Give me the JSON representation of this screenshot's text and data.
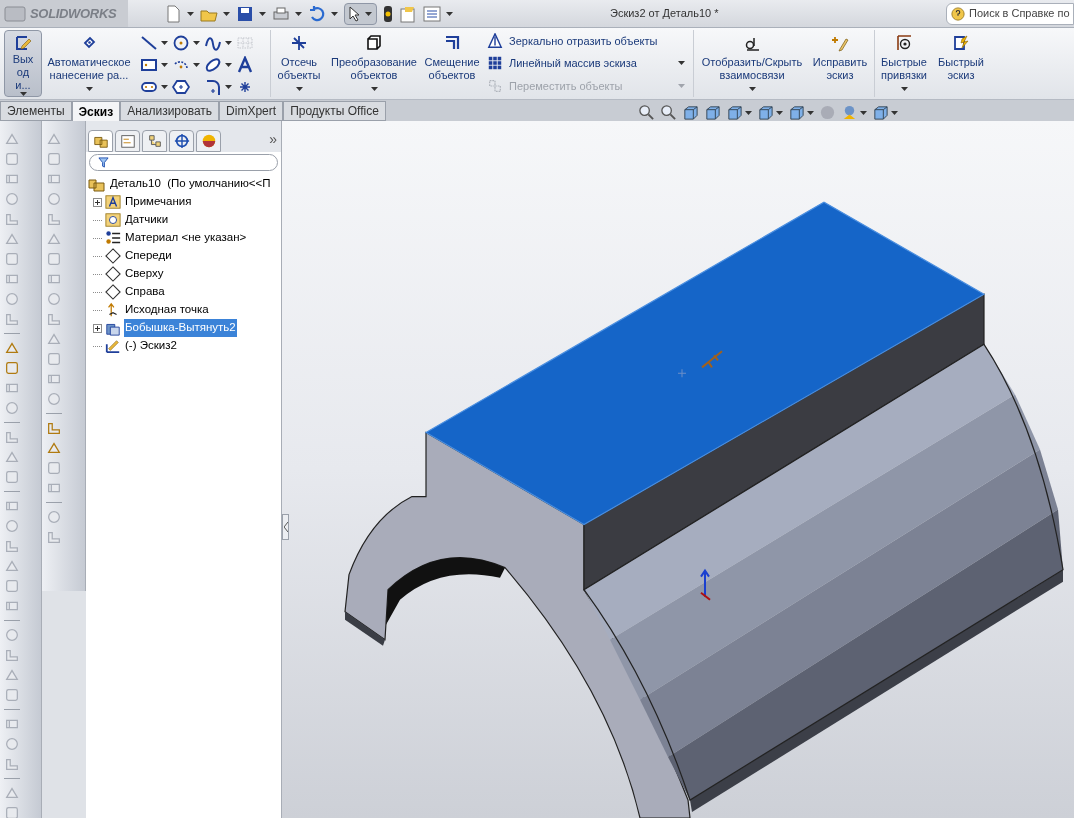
{
  "app": {
    "logo": "SOLIDWORKS",
    "title": "Эскиз2 от Деталь10 *",
    "search": {
      "placeholder": "Поиск в Справке по"
    }
  },
  "ribbon": {
    "primary": [
      {
        "label": "Выход и...",
        "selected": true,
        "dropdown": true
      },
      {
        "label": "Автоматическое нанесение ра...",
        "selected": false,
        "dropdown": true
      }
    ],
    "edit": [
      {
        "label": "Отсечь объекты",
        "dropdown": true
      },
      {
        "label": "Преобразование объектов",
        "dropdown": true
      },
      {
        "label": "Смещение объектов",
        "dropdown": false
      }
    ],
    "list": [
      {
        "label": "Зеркально отразить объекты",
        "disabled": false,
        "dropdown": false
      },
      {
        "label": "Линейный массив эскиза",
        "disabled": false,
        "dropdown": true
      },
      {
        "label": "Переместить объекты",
        "disabled": true,
        "dropdown": true
      }
    ],
    "relations": [
      {
        "label": "Отобразить/Скрыть взаимосвязи",
        "dropdown": true
      },
      {
        "label": "Исправить эскиз",
        "dropdown": false
      }
    ],
    "snaps": [
      {
        "label": "Быстрые привязки",
        "dropdown": true
      },
      {
        "label": "Быстрый эскиз",
        "dropdown": false
      }
    ]
  },
  "tabs": [
    {
      "label": "Элементы",
      "selected": false
    },
    {
      "label": "Эскиз",
      "selected": true
    },
    {
      "label": "Анализировать",
      "selected": false
    },
    {
      "label": "DimXpert",
      "selected": false
    },
    {
      "label": "Продукты Office",
      "selected": false
    }
  ],
  "tree": {
    "root": "Деталь10  (По умолчанию<<П",
    "children": [
      {
        "label": "Примечания",
        "expandable": true,
        "selected": false
      },
      {
        "label": "Датчики",
        "expandable": false,
        "selected": false
      },
      {
        "label": "Материал <не указан>",
        "expandable": false,
        "selected": false
      },
      {
        "label": "Спереди",
        "expandable": false,
        "selected": false
      },
      {
        "label": "Сверху",
        "expandable": false,
        "selected": false
      },
      {
        "label": "Справа",
        "expandable": false,
        "selected": false
      },
      {
        "label": "Исходная точка",
        "expandable": false,
        "selected": false
      },
      {
        "label": "Бобышка-Вытянуть2",
        "expandable": true,
        "selected": true
      },
      {
        "label": "(-) Эскиз2",
        "expandable": false,
        "selected": false
      }
    ]
  },
  "panel_tabs": [
    {
      "selected": true
    },
    {
      "selected": false
    },
    {
      "selected": false
    },
    {
      "selected": false
    },
    {
      "selected": false
    }
  ],
  "tree_more": "»"
}
